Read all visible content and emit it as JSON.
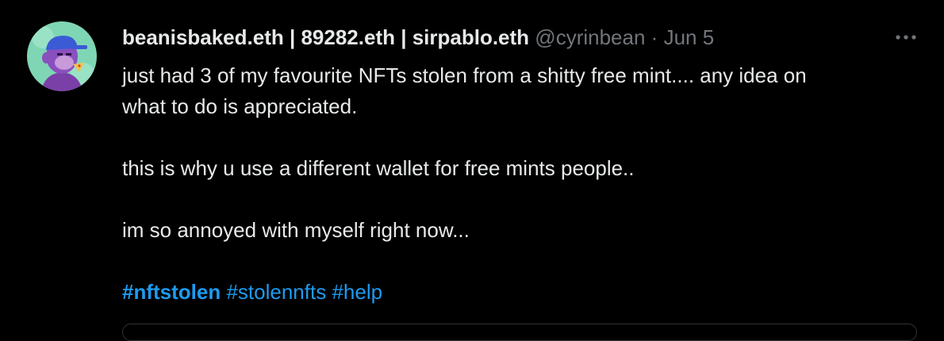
{
  "tweet": {
    "author": {
      "display_name": "beanisbaked.eth | 89282.eth | sirpablo.eth",
      "handle": "@cyrinbean",
      "separator": "·",
      "date": "Jun 5",
      "avatar_icon": "purple-ape-avatar-icon"
    },
    "more_icon": "more-horizontal-icon",
    "text": {
      "line1": "just had 3 of my favourite NFTs stolen from a shitty free mint.... any idea on",
      "line2": "what to do is appreciated.",
      "line3": "this is why u use a different wallet for free mints people..",
      "line4": "im so annoyed with myself right now..."
    },
    "hashtags": [
      "#nftstolen",
      "#stolennfts",
      "#help"
    ],
    "colors": {
      "background": "#000000",
      "text": "#e7e9ea",
      "meta": "#71767b",
      "hashtag": "#1d9bf0"
    }
  }
}
